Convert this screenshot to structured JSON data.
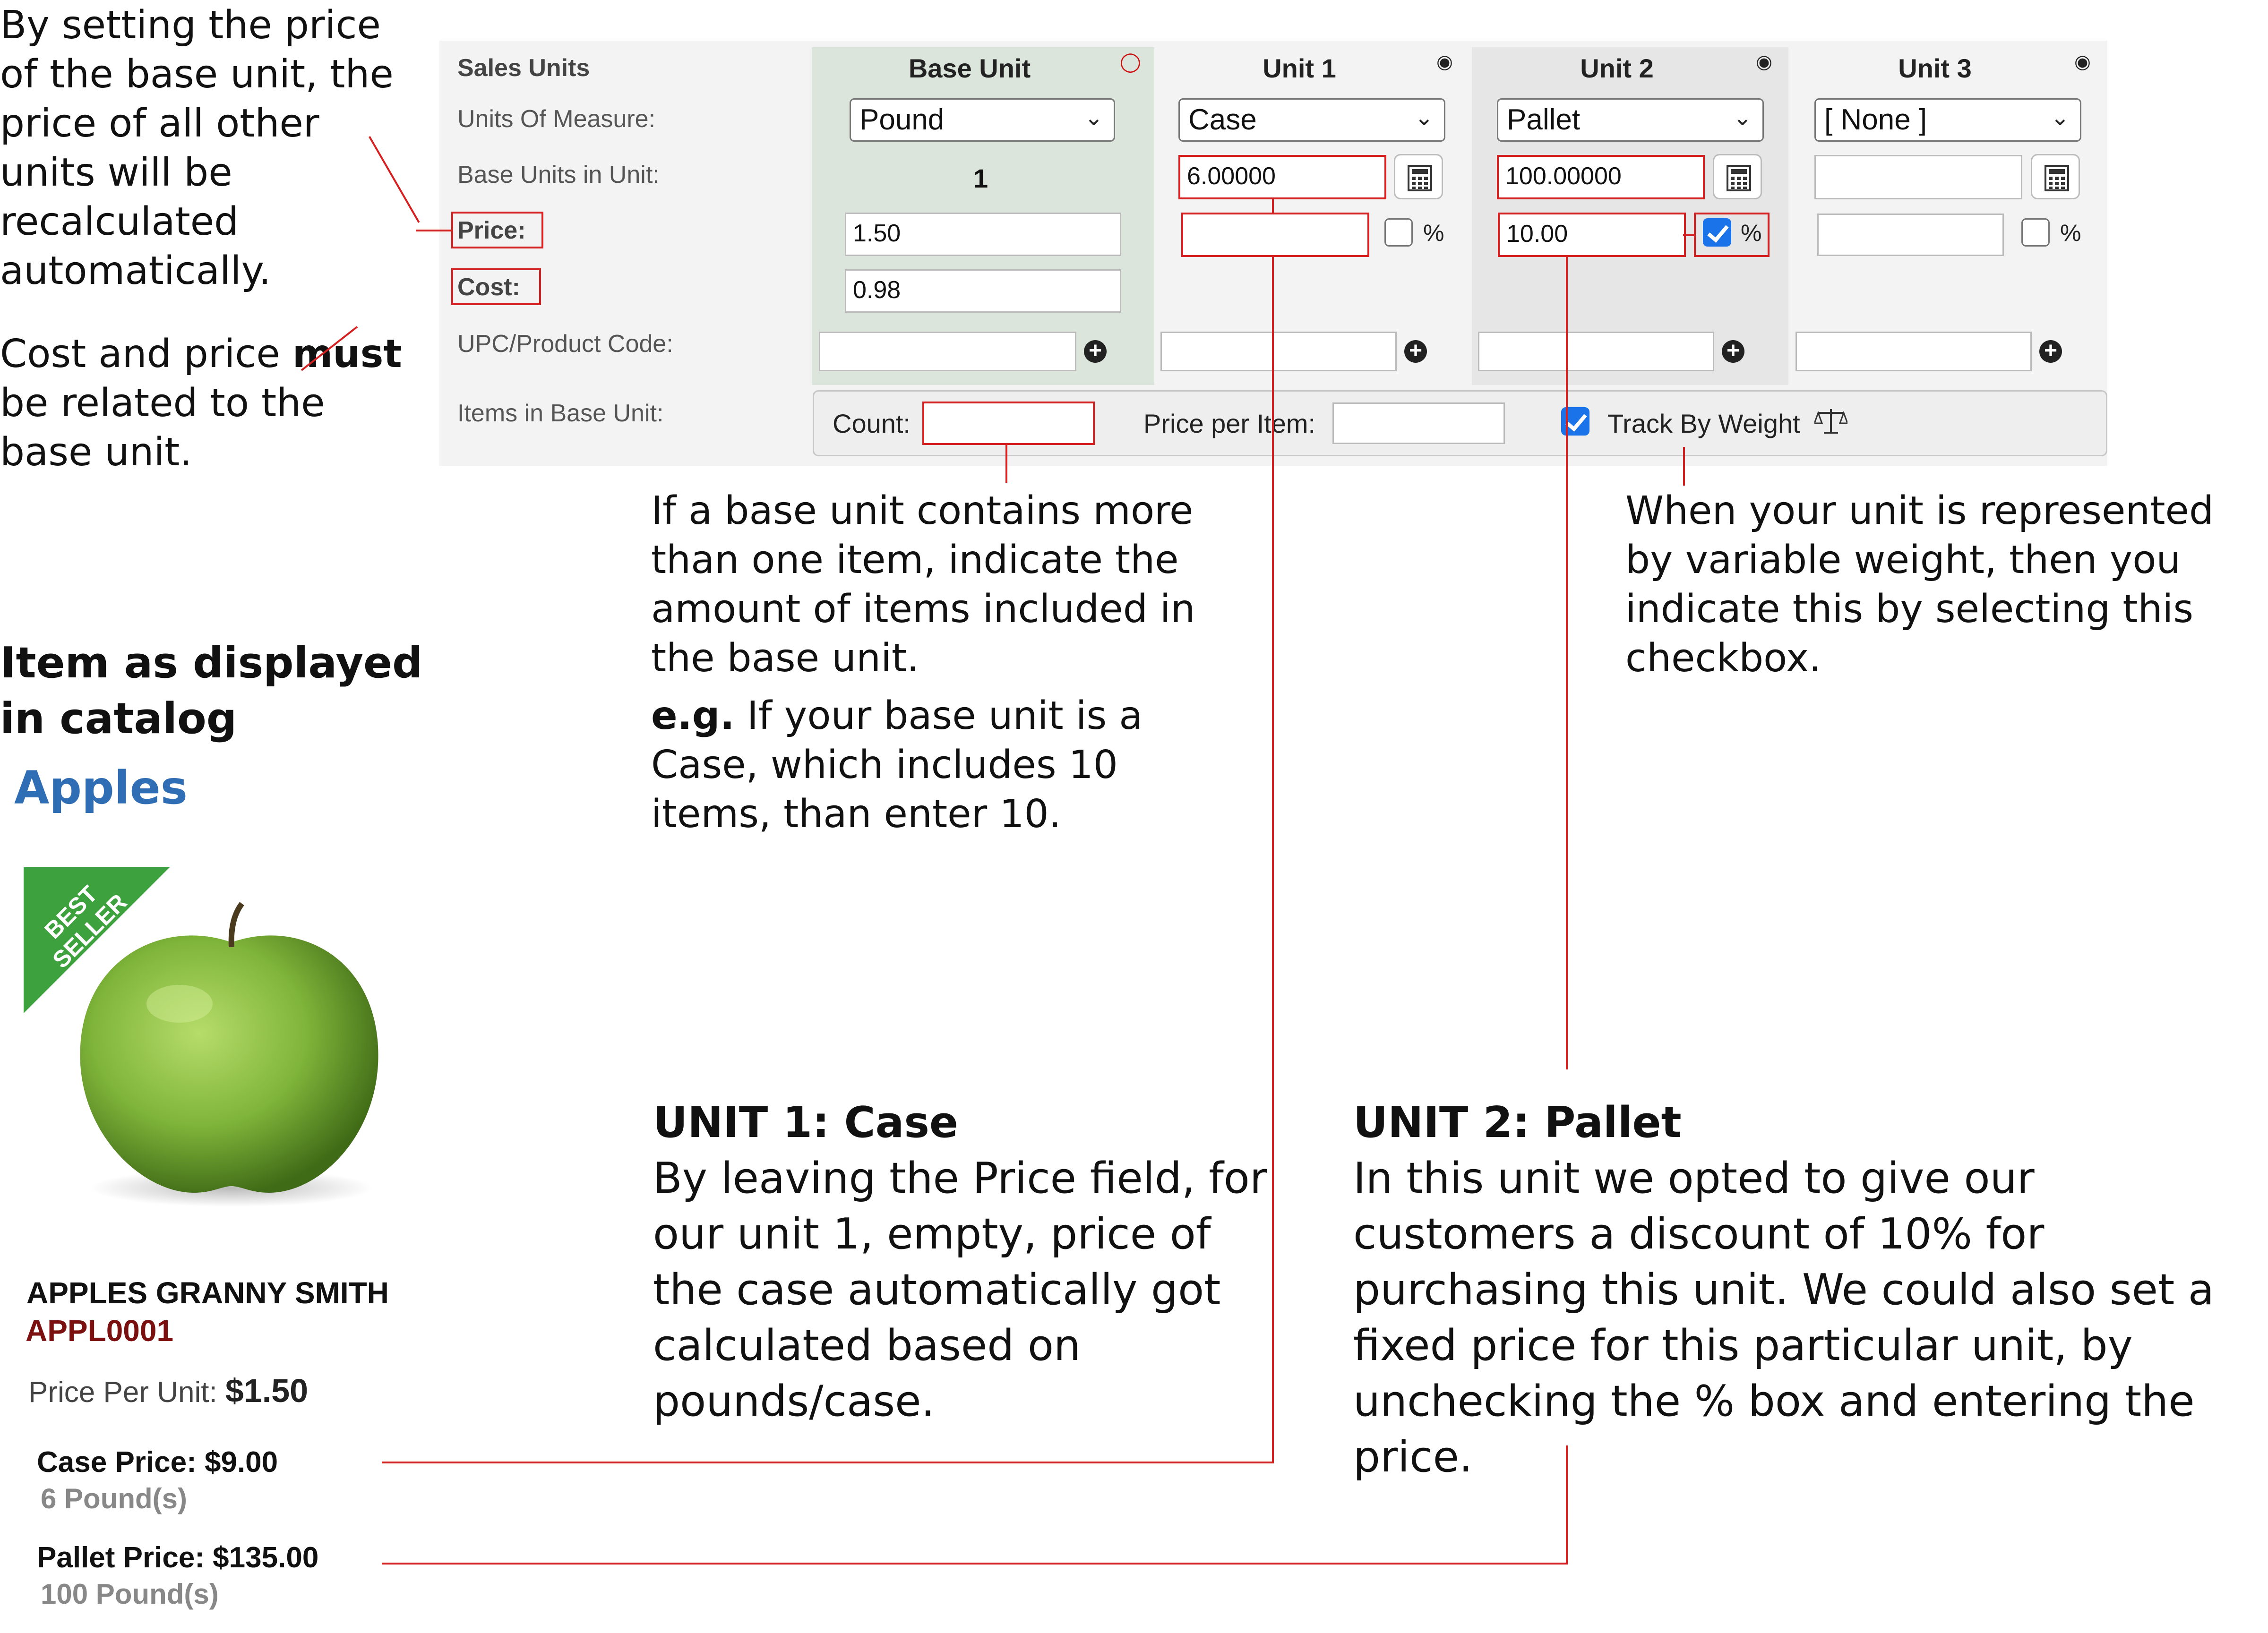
{
  "annotations": {
    "base_price_note": "By setting the price of the base unit, the price of all other units will be recalculated automatically.",
    "cost_note_prefix": "Cost and price ",
    "cost_note_bold": "must",
    "cost_note_suffix": " be related to the base unit.",
    "items_note": "If a base unit contains more than one item, indicate the amount of items included in the base unit.",
    "example_bold": "e.g.",
    "example_text": " If your base unit is a Case, which includes 10 items, than enter 10.",
    "weight_note": "When your unit is represented by variable weight, then you indicate this by selecting this checkbox.",
    "unit1_title": "UNIT 1: Case",
    "unit1_text": "By leaving the Price field, for our unit 1, empty, price of the case automatically got calculated based on pounds/case.",
    "unit2_title": "UNIT 2: Pallet",
    "unit2_text": "In this unit we opted to give our customers a discount of 10% for purchasing this unit. We could also set a fixed price for this particular unit, by unchecking the % box and entering the price."
  },
  "form": {
    "section_label": "Sales Units",
    "row_labels": {
      "uom": "Units Of Measure:",
      "base_units": "Base Units in Unit:",
      "price": "Price:",
      "cost": "Cost:",
      "upc": "UPC/Product Code:",
      "items": "Items in Base Unit:"
    },
    "columns": [
      {
        "header": "Base Unit",
        "uom": "Pound",
        "base_units": "1",
        "price": "1.50",
        "cost": "0.98",
        "icon": "eye-slash-icon"
      },
      {
        "header": "Unit 1",
        "uom": "Case",
        "base_units": "6.00000",
        "price": "",
        "percent_checked": false,
        "icon": "eye-icon"
      },
      {
        "header": "Unit 2",
        "uom": "Pallet",
        "base_units": "100.00000",
        "price": "10.00",
        "percent_checked": true,
        "icon": "eye-icon"
      },
      {
        "header": "Unit 3",
        "uom": "[ None ]",
        "base_units": "",
        "price": "",
        "percent_checked": false,
        "icon": "eye-icon"
      }
    ],
    "percent_symbol": "%",
    "count_label": "Count:",
    "count_value": "",
    "price_per_item_label": "Price per Item:",
    "price_per_item_value": "",
    "track_by_weight_label": "Track By Weight",
    "track_by_weight_checked": true
  },
  "catalog": {
    "heading": "Item as displayed in catalog",
    "item_title": "Apples",
    "badge": "BEST SELLER",
    "product_name": "APPLES GRANNY SMITH",
    "sku": "APPL0001",
    "price_per_unit_label": "Price Per Unit:",
    "price_per_unit_value": "$1.50",
    "case_price": "Case Price: $9.00",
    "case_sub": "6 Pound(s)",
    "pallet_price": "Pallet Price: $135.00",
    "pallet_sub": "100 Pound(s)"
  },
  "colors": {
    "accent_red": "#d42020",
    "link_blue": "#2f6db5",
    "checkbox_blue": "#1a73e8",
    "apple_green": "#7fb53a"
  }
}
